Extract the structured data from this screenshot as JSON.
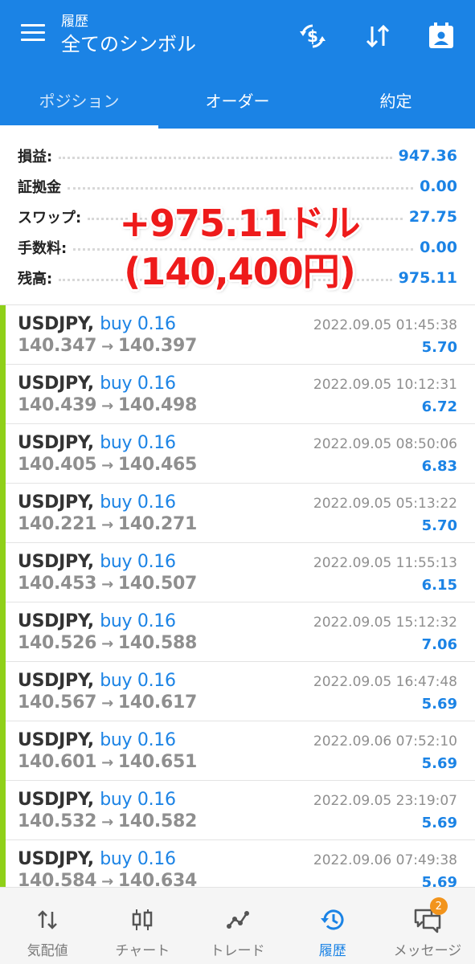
{
  "header": {
    "subtitle": "履歴",
    "title": "全てのシンボル",
    "icons": [
      "menu-icon",
      "currency-exchange-icon",
      "sort-icon",
      "calendar-user-icon"
    ]
  },
  "tabs": [
    {
      "label": "ポジション",
      "active": true
    },
    {
      "label": "オーダー",
      "active": false
    },
    {
      "label": "約定",
      "active": false
    }
  ],
  "summary": {
    "profit": {
      "label": "損益:",
      "value": "947.36"
    },
    "margin": {
      "label": "証拠金",
      "value": "0.00"
    },
    "swap": {
      "label": "スワップ:",
      "value": "27.75"
    },
    "commission": {
      "label": "手数料:",
      "value": "0.00"
    },
    "balance": {
      "label": "残高:",
      "value": "975.11"
    }
  },
  "overlay": {
    "line1": "+975.11ドル",
    "line2": "(140,400円)"
  },
  "deals": [
    {
      "symbol": "USDJPY,",
      "side": "buy 0.16",
      "open": "140.347",
      "arrow": "→",
      "close": "140.397",
      "time": "2022.09.05 01:45:38",
      "profit": "5.70"
    },
    {
      "symbol": "USDJPY,",
      "side": "buy 0.16",
      "open": "140.439",
      "arrow": "→",
      "close": "140.498",
      "time": "2022.09.05 10:12:31",
      "profit": "6.72"
    },
    {
      "symbol": "USDJPY,",
      "side": "buy 0.16",
      "open": "140.405",
      "arrow": "→",
      "close": "140.465",
      "time": "2022.09.05 08:50:06",
      "profit": "6.83"
    },
    {
      "symbol": "USDJPY,",
      "side": "buy 0.16",
      "open": "140.221",
      "arrow": "→",
      "close": "140.271",
      "time": "2022.09.05 05:13:22",
      "profit": "5.70"
    },
    {
      "symbol": "USDJPY,",
      "side": "buy 0.16",
      "open": "140.453",
      "arrow": "→",
      "close": "140.507",
      "time": "2022.09.05 11:55:13",
      "profit": "6.15"
    },
    {
      "symbol": "USDJPY,",
      "side": "buy 0.16",
      "open": "140.526",
      "arrow": "→",
      "close": "140.588",
      "time": "2022.09.05 15:12:32",
      "profit": "7.06"
    },
    {
      "symbol": "USDJPY,",
      "side": "buy 0.16",
      "open": "140.567",
      "arrow": "→",
      "close": "140.617",
      "time": "2022.09.05 16:47:48",
      "profit": "5.69"
    },
    {
      "symbol": "USDJPY,",
      "side": "buy 0.16",
      "open": "140.601",
      "arrow": "→",
      "close": "140.651",
      "time": "2022.09.06 07:52:10",
      "profit": "5.69"
    },
    {
      "symbol": "USDJPY,",
      "side": "buy 0.16",
      "open": "140.532",
      "arrow": "→",
      "close": "140.582",
      "time": "2022.09.05 23:19:07",
      "profit": "5.69"
    },
    {
      "symbol": "USDJPY,",
      "side": "buy 0.16",
      "open": "140.584",
      "arrow": "→",
      "close": "140.634",
      "time": "2022.09.06 07:49:38",
      "profit": "5.69"
    }
  ],
  "bottom_nav": [
    {
      "label": "気配値",
      "icon": "quotes-icon",
      "active": false
    },
    {
      "label": "チャート",
      "icon": "chart-icon",
      "active": false
    },
    {
      "label": "トレード",
      "icon": "trade-icon",
      "active": false
    },
    {
      "label": "履歴",
      "icon": "history-icon",
      "active": true
    },
    {
      "label": "メッセージ",
      "icon": "messages-icon",
      "active": false,
      "badge": "2"
    }
  ],
  "colors": {
    "primary": "#1b83e5",
    "buy_bar": "#8fd019",
    "overlay_text": "#ee1b1b",
    "badge": "#f2941c"
  }
}
